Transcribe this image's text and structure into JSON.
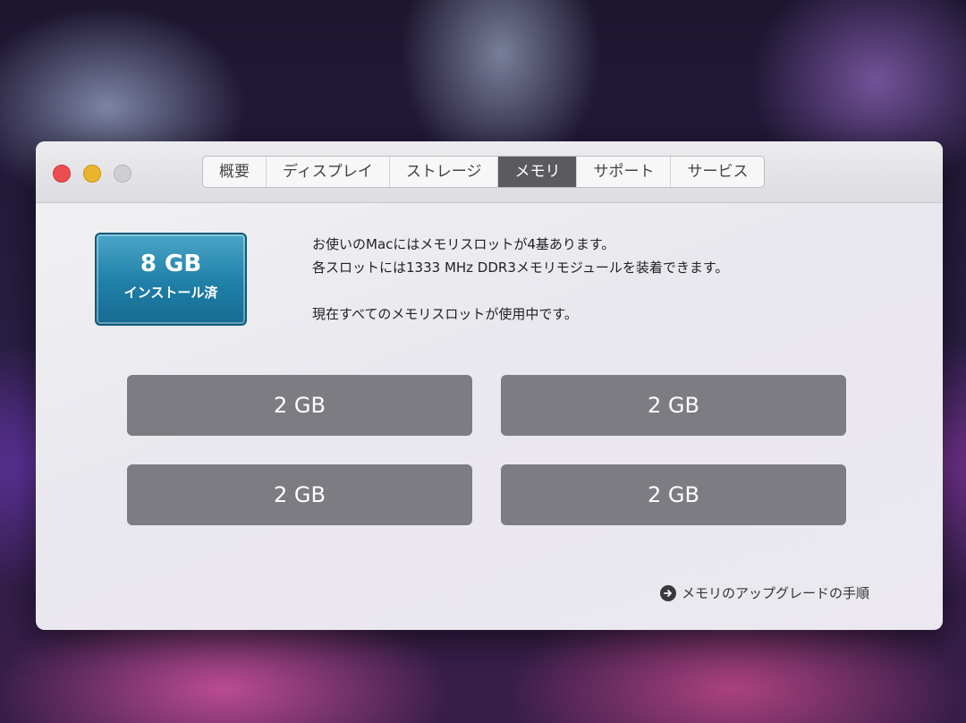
{
  "window": {
    "tabs": [
      {
        "label": "概要"
      },
      {
        "label": "ディスプレイ"
      },
      {
        "label": "ストレージ"
      },
      {
        "label": "メモリ"
      },
      {
        "label": "サポート"
      },
      {
        "label": "サービス"
      }
    ],
    "active_tab": "メモリ"
  },
  "memory": {
    "total": "8 GB",
    "total_label": "インストール済",
    "info_lines": [
      "お使いのMacにはメモリスロットが4基あります。",
      "各スロットには1333 MHz DDR3メモリモジュールを装着できます。",
      "現在すべてのメモリスロットが使用中です。"
    ],
    "slots": [
      "2 GB",
      "2 GB",
      "2 GB",
      "2 GB"
    ],
    "upgrade_link": "メモリのアップグレードの手順"
  },
  "colors": {
    "badge": "#1f7fa7",
    "slot": "#7d7c82",
    "active_tab": "#5b5a5f",
    "close": "#ec4d50",
    "minimize": "#e8b52c",
    "zoom": "#cfced2"
  },
  "icons": {
    "close": "close-icon",
    "minimize": "minimize-icon",
    "zoom": "zoom-icon",
    "link_arrow": "arrow-right-circle-icon"
  }
}
